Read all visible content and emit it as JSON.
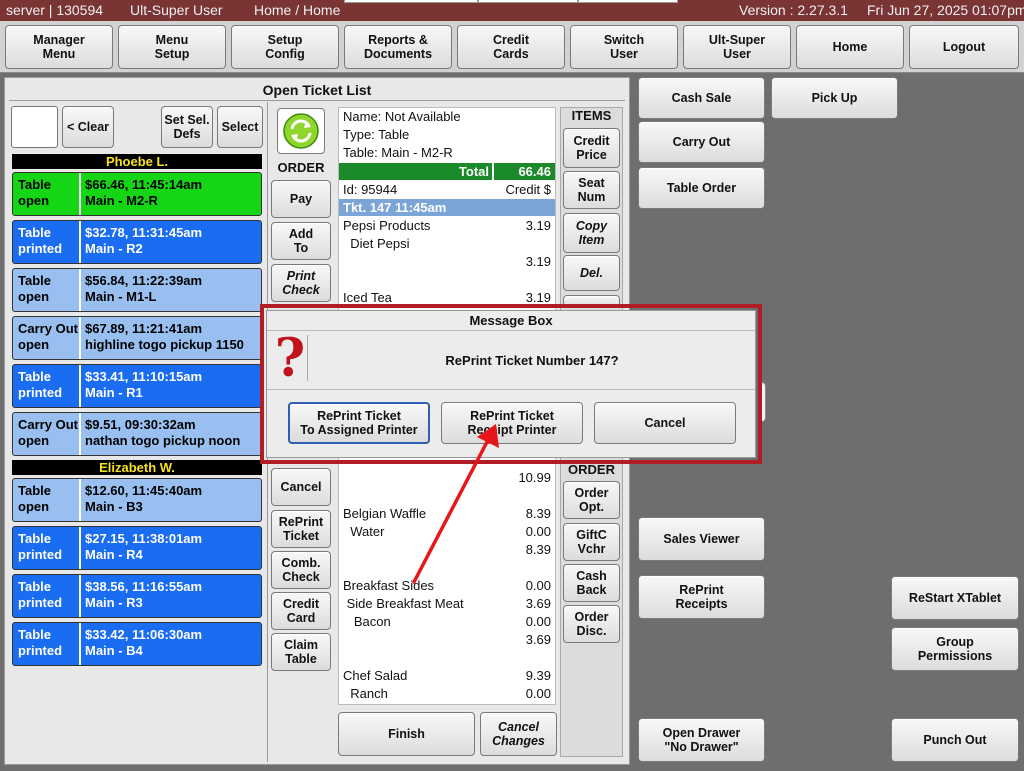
{
  "titlebar": {
    "server": "server | 130594",
    "user": "Ult-Super User",
    "location": "Home / Home",
    "version": "Version : 2.27.3.1",
    "datetime": "Fri Jun 27, 2025  01:07pm"
  },
  "nav": {
    "manager_menu": "Manager\nMenu",
    "menu_setup": "Menu\nSetup",
    "setup_config": "Setup\nConfig",
    "reports_documents": "Reports &\nDocuments",
    "credit_cards": "Credit\nCards",
    "switch_user": "Switch\nUser",
    "ult_super_user": "Ult-Super\nUser",
    "home": "Home",
    "logout": "Logout"
  },
  "panel": {
    "title": "Open Ticket List",
    "clear": "< Clear",
    "set_sel_defs": "Set Sel.\nDefs",
    "select": "Select"
  },
  "servers": [
    {
      "name": "Phoebe L."
    },
    {
      "name": "Elizabeth W."
    }
  ],
  "tickets": [
    {
      "col1": "Table\nopen",
      "col2": "$66.46, 11:45:14am\nMain - M2-R",
      "color": "#14d614"
    },
    {
      "col1": "Table\nprinted",
      "col2": "$32.78, 11:31:45am\nMain - R2",
      "color": "#1a6cf0"
    },
    {
      "col1": "Table\nopen",
      "col2": "$56.84, 11:22:39am\nMain - M1-L",
      "color": "#98bff0"
    },
    {
      "col1": "Carry Out\nopen",
      "col2": "$67.89, 11:21:41am\nhighline togo pickup 1150",
      "color": "#98bff0"
    },
    {
      "col1": "Table\nprinted",
      "col2": "$33.41, 11:10:15am\nMain - R1",
      "color": "#1a6cf0"
    },
    {
      "col1": "Carry Out\nopen",
      "col2": "$9.51, 09:30:32am\nnathan togo pickup noon",
      "color": "#98bff0"
    },
    {
      "col1": "Table\nopen",
      "col2": "$12.60, 11:45:40am\nMain - B3",
      "color": "#98bff0"
    },
    {
      "col1": "Table\nprinted",
      "col2": "$27.15, 11:38:01am\nMain - R4",
      "color": "#1a6cf0"
    },
    {
      "col1": "Table\nprinted",
      "col2": "$38.56, 11:16:55am\nMain - R3",
      "color": "#1a6cf0"
    },
    {
      "col1": "Table\nprinted",
      "col2": "$33.42, 11:06:30am\nMain - B4",
      "color": "#1a6cf0"
    }
  ],
  "order_col": {
    "header": "ORDER",
    "pay": "Pay",
    "add_to": "Add\nTo",
    "print_check": "Print\nCheck",
    "cancel": "Cancel",
    "reprint_ticket": "RePrint\nTicket",
    "comb_check": "Comb.\nCheck",
    "credit_card": "Credit\nCard",
    "claim_table": "Claim\nTable"
  },
  "receipt": {
    "name": "Name: Not Available",
    "type": "Type: Table",
    "table": "Table: Main - M2-R",
    "total_label": "Total",
    "total_value": "66.46",
    "id": "Id: 95944",
    "credit": "Credit $",
    "tkt": "Tkt. 147  11:45am",
    "lines": [
      {
        "label": "Pepsi Products",
        "value": "3.19"
      },
      {
        "label": "  Diet Pepsi",
        "value": ""
      },
      {
        "label": "",
        "value": "3.19"
      },
      {
        "label": "Iced Tea",
        "value": "3.19"
      },
      {
        "label": "",
        "value": "10.99"
      },
      {
        "label": "Belgian  Waffle",
        "value": "8.39"
      },
      {
        "label": "  Water",
        "value": "0.00"
      },
      {
        "label": "",
        "value": "8.39"
      },
      {
        "label": "Breakfast Sides",
        "value": "0.00"
      },
      {
        "label": " Side Breakfast Meat",
        "value": "3.69"
      },
      {
        "label": "   Bacon",
        "value": "0.00"
      },
      {
        "label": "",
        "value": "3.69"
      },
      {
        "label": "Chef Salad",
        "value": "9.39"
      },
      {
        "label": "  Ranch",
        "value": "0.00"
      }
    ],
    "finish": "Finish",
    "cancel_changes": "Cancel\nChanges"
  },
  "items_col": {
    "header": "ITEMS",
    "credit_price": "Credit\nPrice",
    "seat_num": "Seat\nNum",
    "copy_item": "Copy\nItem",
    "del": "Del.",
    "order_header": "ORDER",
    "order_opt": "Order\nOpt.",
    "giftc_vchr": "GiftC\nVchr",
    "cash_back": "Cash\nBack",
    "order_disc": "Order\nDisc."
  },
  "right": {
    "cash_sale": "Cash Sale",
    "pick_up": "Pick Up",
    "carry_out": "Carry Out",
    "table_order": "Table Order",
    "sales_viewer": "Sales Viewer",
    "reprint_receipts": "RePrint\nReceipts",
    "restart_xtablet": "ReStart XTablet",
    "group_permissions": "Group\nPermissions",
    "open_drawer": "Open Drawer\n\"No Drawer\"",
    "punch_out": "Punch Out"
  },
  "modal": {
    "title": "Message Box",
    "icon": "?",
    "message": "RePrint Ticket Number 147?",
    "btn_assigned": "RePrint Ticket\nTo Assigned Printer",
    "btn_receipt": "RePrint Ticket\nReceipt Printer",
    "btn_cancel": "Cancel"
  },
  "colors": {
    "titlebar": "#7a3434",
    "modal_border": "#b21d25",
    "total_bar": "#1b8a2a",
    "tkt_bar": "#7aa5d6",
    "arrow": "#e8151b"
  }
}
